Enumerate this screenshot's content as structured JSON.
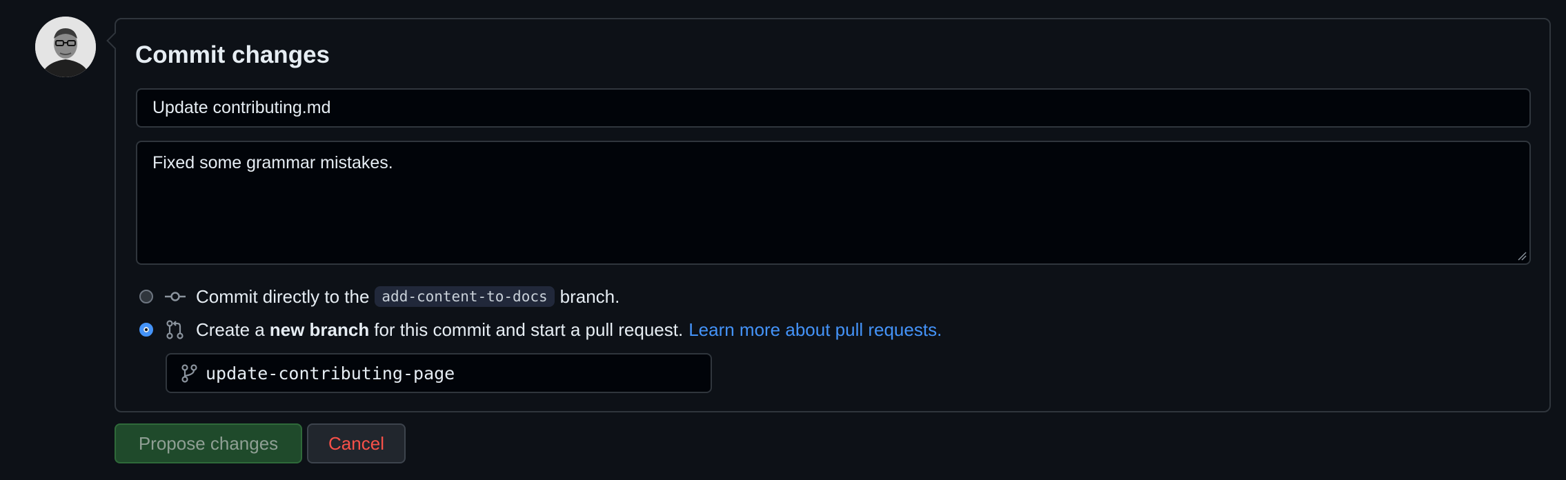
{
  "commit_box": {
    "title": "Commit changes",
    "summary_value": "Update contributing.md",
    "description_value": "Fixed some grammar mistakes."
  },
  "options": {
    "direct": {
      "selected": false,
      "prefix": "Commit directly to the",
      "branch": "add-content-to-docs",
      "suffix": "branch.",
      "icon": "git-commit-icon"
    },
    "new_branch": {
      "selected": true,
      "prefix": "Create a",
      "bold": "new branch",
      "suffix": "for this commit and start a pull request.",
      "link": "Learn more about pull requests.",
      "icon": "git-pull-request-icon"
    }
  },
  "branch_name": {
    "value": "update-contributing-page",
    "icon": "git-branch-icon"
  },
  "actions": {
    "propose_label": "Propose changes",
    "cancel_label": "Cancel"
  },
  "colors": {
    "background": "#0d1117",
    "border": "#30363d",
    "link": "#4493f8",
    "propose_bg": "#1f4a2b",
    "cancel_text": "#f85149"
  }
}
